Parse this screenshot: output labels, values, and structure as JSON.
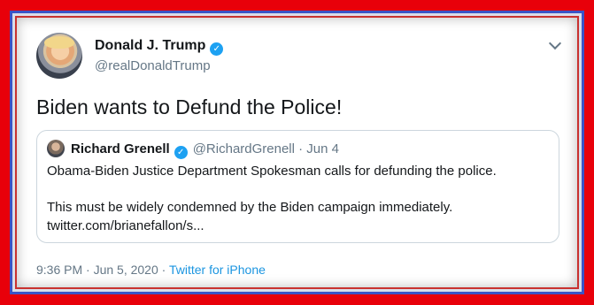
{
  "tweet": {
    "author_name": "Donald J. Trump",
    "author_handle": "@realDonaldTrump",
    "text": "Biden wants to Defund the Police!",
    "timestamp": "9:36 PM · Jun 5, 2020 ·",
    "source": "Twitter for iPhone"
  },
  "quoted_tweet": {
    "author_name": "Richard Grenell",
    "meta": "@RichardGrenell · Jun 4",
    "line1": "Obama-Biden Justice Department Spokesman calls for defunding the police.",
    "line2": "This must be widely condemned by the Biden campaign immediately.",
    "line3": "twitter.com/brianefallon/s..."
  },
  "icons": {
    "verified": "verified-badge-icon",
    "menu": "chevron-down-icon"
  },
  "colors": {
    "outer_frame": "#e8000a",
    "inner_frame": "#3a54c6",
    "verified": "#1da1f2",
    "link": "#1b95e0"
  }
}
